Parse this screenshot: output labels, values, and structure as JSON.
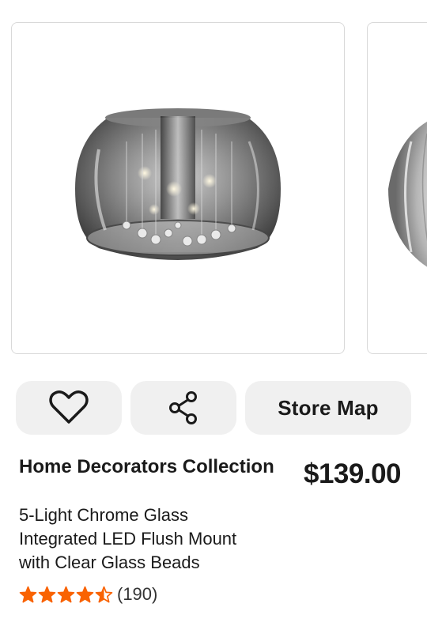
{
  "product": {
    "brand": "Home Decorators Collection",
    "price": "$139.00",
    "title_lines": [
      "5-Light Chrome Glass",
      "Integrated LED Flush Mount",
      "with Clear Glass Beads"
    ],
    "rating": 4.5,
    "rating_max": 5,
    "review_count": "(190)"
  },
  "actions": {
    "favorite_icon": "heart-icon",
    "share_icon": "share-icon",
    "store_map_label": "Store Map"
  },
  "colors": {
    "star": "#f96302",
    "button_bg": "#f0f0f0",
    "text": "#1a1a1a"
  }
}
